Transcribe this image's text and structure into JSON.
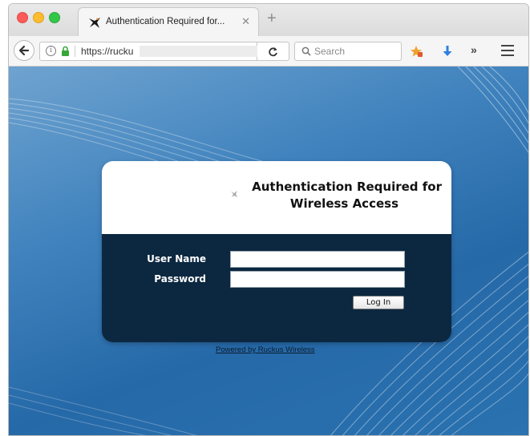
{
  "browser": {
    "tab": {
      "title": "Authentication Required for..."
    },
    "address": {
      "url": "https://rucku"
    },
    "search": {
      "placeholder": "Search"
    },
    "toolbar": {
      "overflow_label": "»"
    }
  },
  "login": {
    "title_line1": "Authentication Required for",
    "title_line2": "Wireless Access",
    "username_label": "User Name",
    "password_label": "Password",
    "login_button": "Log In",
    "powered_by": "Powered by Ruckus Wireless"
  },
  "colors": {
    "card_dark": "#0c2840",
    "background_blue": "#2669a8",
    "traffic_red": "#fc5b57",
    "traffic_yellow": "#fdbc2e",
    "traffic_green": "#33c748"
  }
}
